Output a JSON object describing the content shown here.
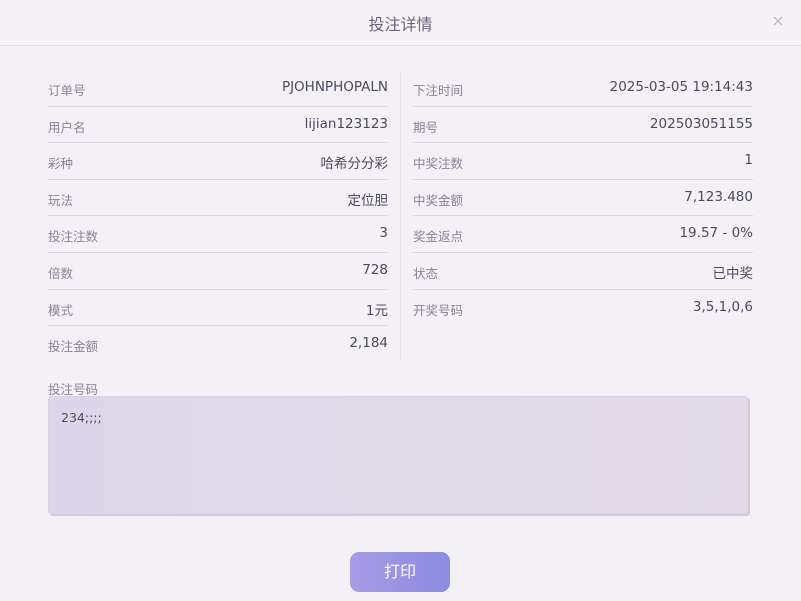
{
  "dialog": {
    "title": "投注详情",
    "close_icon": "close-icon"
  },
  "left": [
    {
      "label": "订单号",
      "value": "PJOHNPHOPALN"
    },
    {
      "label": "用户名",
      "value": "lijian123123"
    },
    {
      "label": "彩种",
      "value": "哈希分分彩"
    },
    {
      "label": "玩法",
      "value": "定位胆"
    },
    {
      "label": "投注注数",
      "value": "3"
    },
    {
      "label": "倍数",
      "value": "728"
    },
    {
      "label": "模式",
      "value": "1元"
    },
    {
      "label": "投注金额",
      "value": "2,184"
    }
  ],
  "right": [
    {
      "label": "下注时间",
      "value": "2025-03-05 19:14:43"
    },
    {
      "label": "期号",
      "value": "202503051155"
    },
    {
      "label": "中奖注数",
      "value": "1"
    },
    {
      "label": "中奖金额",
      "value": "7,123.480"
    },
    {
      "label": "奖金返点",
      "value": "19.57 - 0%"
    },
    {
      "label": "状态",
      "value": "已中奖"
    },
    {
      "label": "开奖号码",
      "value": "3,5,1,0,6"
    }
  ],
  "bet_numbers": {
    "label": "投注号码",
    "value": "234;;;;"
  },
  "actions": {
    "print_label": "打印"
  },
  "colors": {
    "accent_start": "#a99ae6",
    "accent_end": "#8a8ce2",
    "background": "#f4f1f6"
  }
}
